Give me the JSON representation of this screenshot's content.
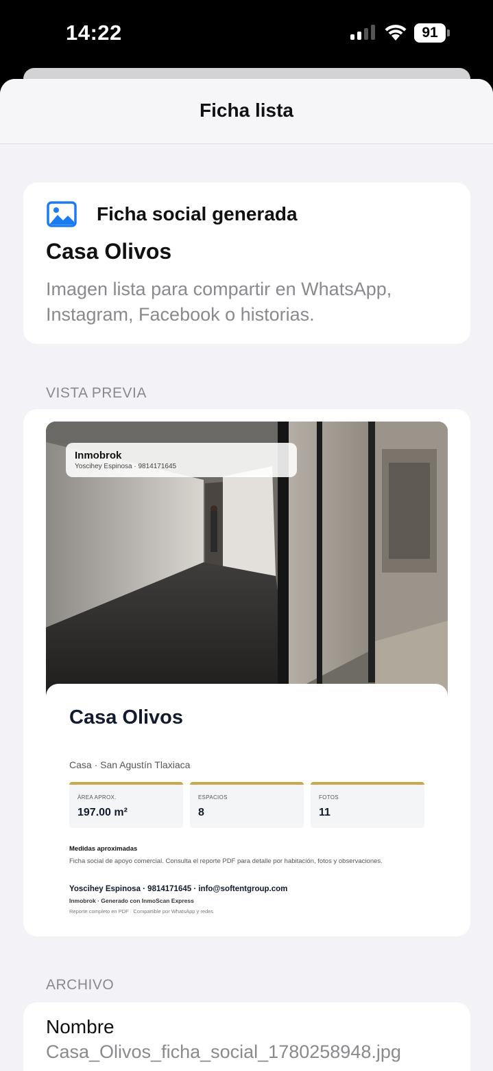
{
  "status": {
    "time": "14:22",
    "battery": "91"
  },
  "nav": {
    "title": "Ficha lista"
  },
  "summary": {
    "icon": "photo-icon",
    "heading": "Ficha social generada",
    "title": "Casa Olivos",
    "description": "Imagen lista para compartir en WhatsApp, Instagram, Facebook o historias."
  },
  "preview": {
    "section_label": "VISTA PREVIA",
    "brand_name": "Inmobrok",
    "brand_contact": "Yoscihey Espinosa · 9814171645",
    "property_title": "Casa Olivos",
    "property_subtitle": "Casa · San Agustín Tlaxiaca",
    "stats": [
      {
        "label": "ÁREA APROX.",
        "value": "197.00 m²"
      },
      {
        "label": "ESPACIOS",
        "value": "8"
      },
      {
        "label": "FOTOS",
        "value": "11"
      }
    ],
    "measures_title": "Medidas aproximadas",
    "measures_text": "Ficha social de apoyo comercial. Consulta el reporte PDF para detalle por habitación, fotos y observaciones.",
    "contact_line": "Yoscihey Espinosa · 9814171645 · info@softentgroup.com",
    "generated_line": "Inmobrok · Generado con InmoScan Express",
    "footer_line": "Reporte completo en PDF · Compartible por WhatsApp y redes",
    "accent_color": "#c9a94c"
  },
  "file": {
    "section_label": "ARCHIVO",
    "name_label": "Nombre",
    "name_value": "Casa_Olivos_ficha_social_1780258948.jpg"
  }
}
